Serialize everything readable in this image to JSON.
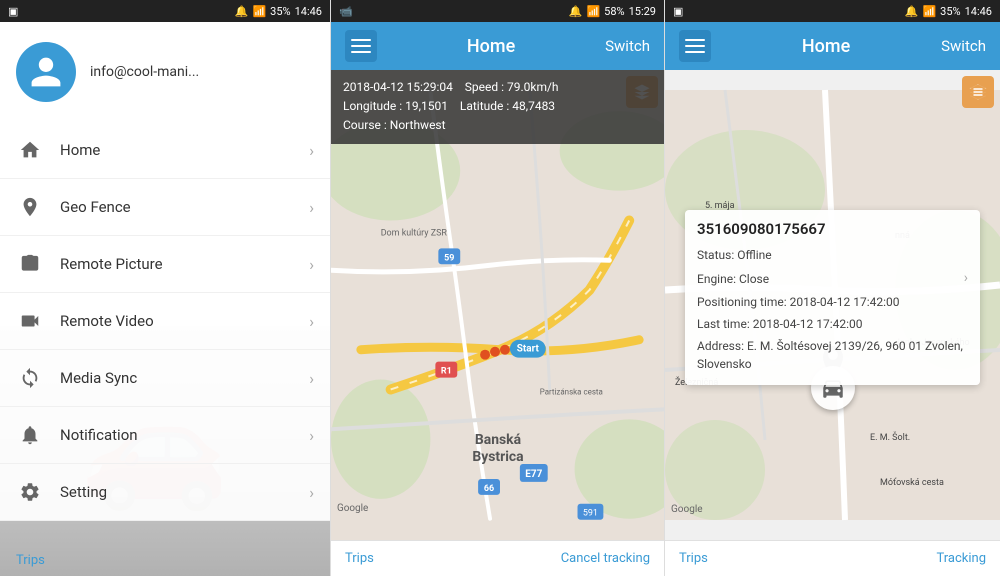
{
  "panel1": {
    "statusBar": {
      "time": "14:46",
      "battery": "35%"
    },
    "user": {
      "email": "info@cool-mani...",
      "avatarIcon": "person-icon"
    },
    "menuItems": [
      {
        "id": "home",
        "label": "Home",
        "icon": "home-icon"
      },
      {
        "id": "geo-fence",
        "label": "Geo Fence",
        "icon": "geofence-icon"
      },
      {
        "id": "remote-picture",
        "label": "Remote Picture",
        "icon": "camera-icon"
      },
      {
        "id": "remote-video",
        "label": "Remote Video",
        "icon": "video-icon"
      },
      {
        "id": "media-sync",
        "label": "Media Sync",
        "icon": "sync-icon"
      },
      {
        "id": "notification",
        "label": "Notification",
        "icon": "notification-icon"
      },
      {
        "id": "setting",
        "label": "Setting",
        "icon": "setting-icon"
      }
    ],
    "tripsLink": "Trips"
  },
  "panel2": {
    "statusBar": {
      "time": "15:29",
      "battery": "58%"
    },
    "header": {
      "title": "Home",
      "switchLabel": "Switch"
    },
    "infoOverlay": {
      "datetime": "2018-04-12 15:29:04",
      "speed": "Speed : 79.0km/h",
      "longitude": "Longitude : 19,1501",
      "latitude": "Latitude : 48,7483",
      "course": "Course : Northwest"
    },
    "mapCity": "Banská Bystrica",
    "startLabel": "Start",
    "googleWatermark": "Google",
    "bottomBar": {
      "tripsLabel": "Trips",
      "cancelLabel": "Cancel tracking"
    }
  },
  "panel3": {
    "statusBar": {
      "time": "14:46",
      "battery": "35%"
    },
    "header": {
      "title": "Home",
      "switchLabel": "Switch"
    },
    "deviceInfo": {
      "id": "351609080175667",
      "status": "Status:  Offline",
      "engine": "Engine:  Close",
      "positioningTime": "Positioning time:  2018-04-12 17:42:00",
      "lastTime": "Last time:  2018-04-12 17:42:00",
      "address": "Address:  E. M. Šoltésovej 2139/26, 960 01 Zvolen, Slovensko"
    },
    "googleWatermark": "Google",
    "bottomBar": {
      "tripsLabel": "Trips",
      "trackingLabel": "Tracking"
    }
  }
}
